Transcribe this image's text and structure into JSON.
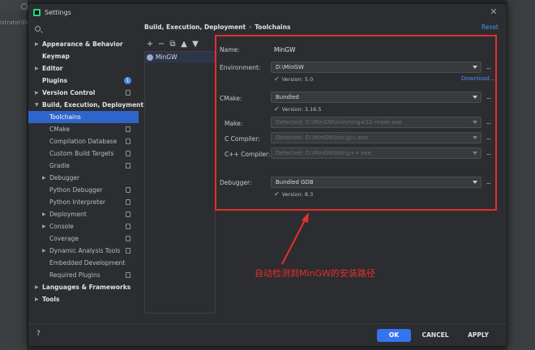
{
  "background": {
    "left_crumb": "istrator\\Dc"
  },
  "dialog": {
    "title": "Settings",
    "reset_label": "Reset",
    "breadcrumb": [
      "Build, Execution, Deployment",
      "Toolchains"
    ]
  },
  "tree": [
    {
      "label": "Appearance & Behavior",
      "bold": true,
      "arrow": "right"
    },
    {
      "label": "Keymap",
      "bold": true
    },
    {
      "label": "Editor",
      "bold": true,
      "arrow": "right"
    },
    {
      "label": "Plugins",
      "bold": true,
      "badge": "1"
    },
    {
      "label": "Version Control",
      "bold": true,
      "arrow": "right",
      "copy": true
    },
    {
      "label": "Build, Execution, Deployment",
      "bold": true,
      "arrow": "down"
    },
    {
      "label": "Toolchains",
      "child": true,
      "selected": true
    },
    {
      "label": "CMake",
      "child": true,
      "copy": true
    },
    {
      "label": "Compilation Database",
      "child": true,
      "copy": true
    },
    {
      "label": "Custom Build Targets",
      "child": true,
      "copy": true
    },
    {
      "label": "Gradle",
      "child": true,
      "copy": true
    },
    {
      "label": "Debugger",
      "child": true,
      "arrow": "right"
    },
    {
      "label": "Python Debugger",
      "child": true,
      "copy": true
    },
    {
      "label": "Python Interpreter",
      "child": true,
      "copy": true
    },
    {
      "label": "Deployment",
      "child": true,
      "arrow": "right",
      "copy": true
    },
    {
      "label": "Console",
      "child": true,
      "arrow": "right",
      "copy": true
    },
    {
      "label": "Coverage",
      "child": true,
      "copy": true
    },
    {
      "label": "Dynamic Analysis Tools",
      "child": true,
      "arrow": "right",
      "copy": true
    },
    {
      "label": "Embedded Development",
      "child": true
    },
    {
      "label": "Required Plugins",
      "child": true,
      "copy": true
    },
    {
      "label": "Languages & Frameworks",
      "bold": true,
      "arrow": "right"
    },
    {
      "label": "Tools",
      "bold": true,
      "arrow": "right"
    }
  ],
  "toolchains": {
    "toolbar": [
      "+",
      "−",
      "⧉",
      "▲",
      "▼"
    ],
    "items": [
      "MinGW"
    ]
  },
  "form": {
    "name_label": "Name:",
    "name_value": "MinGW",
    "environment_label": "Environment:",
    "environment_value": "D:\\MinGW",
    "environment_status": "Version: 5.0",
    "download_label": "Download...",
    "cmake_label": "CMake:",
    "cmake_value": "Bundled",
    "cmake_status": "Version: 3.16.5",
    "make_label": "Make:",
    "make_value": "Detected: D:\\MinGW\\bin\\mingw32-make.exe",
    "c_label": "C Compiler:",
    "c_value": "Detected: D:\\MinGW\\bin\\gcc.exe",
    "cpp_label": "C++ Compiler:",
    "cpp_value": "Detected: D:\\MinGW\\bin\\g++.exe",
    "debugger_label": "Debugger:",
    "debugger_value": "Bundled GDB",
    "debugger_status": "Version: 8.3",
    "browse": "..."
  },
  "annotation": {
    "text": "自动检测到MinGW的安装路径"
  },
  "buttons": {
    "help": "?",
    "ok": "OK",
    "cancel": "CANCEL",
    "apply": "APPLY"
  },
  "colors": {
    "accent": "#3574f0",
    "highlight": "#e52f2a",
    "selection": "#2f65ca"
  }
}
